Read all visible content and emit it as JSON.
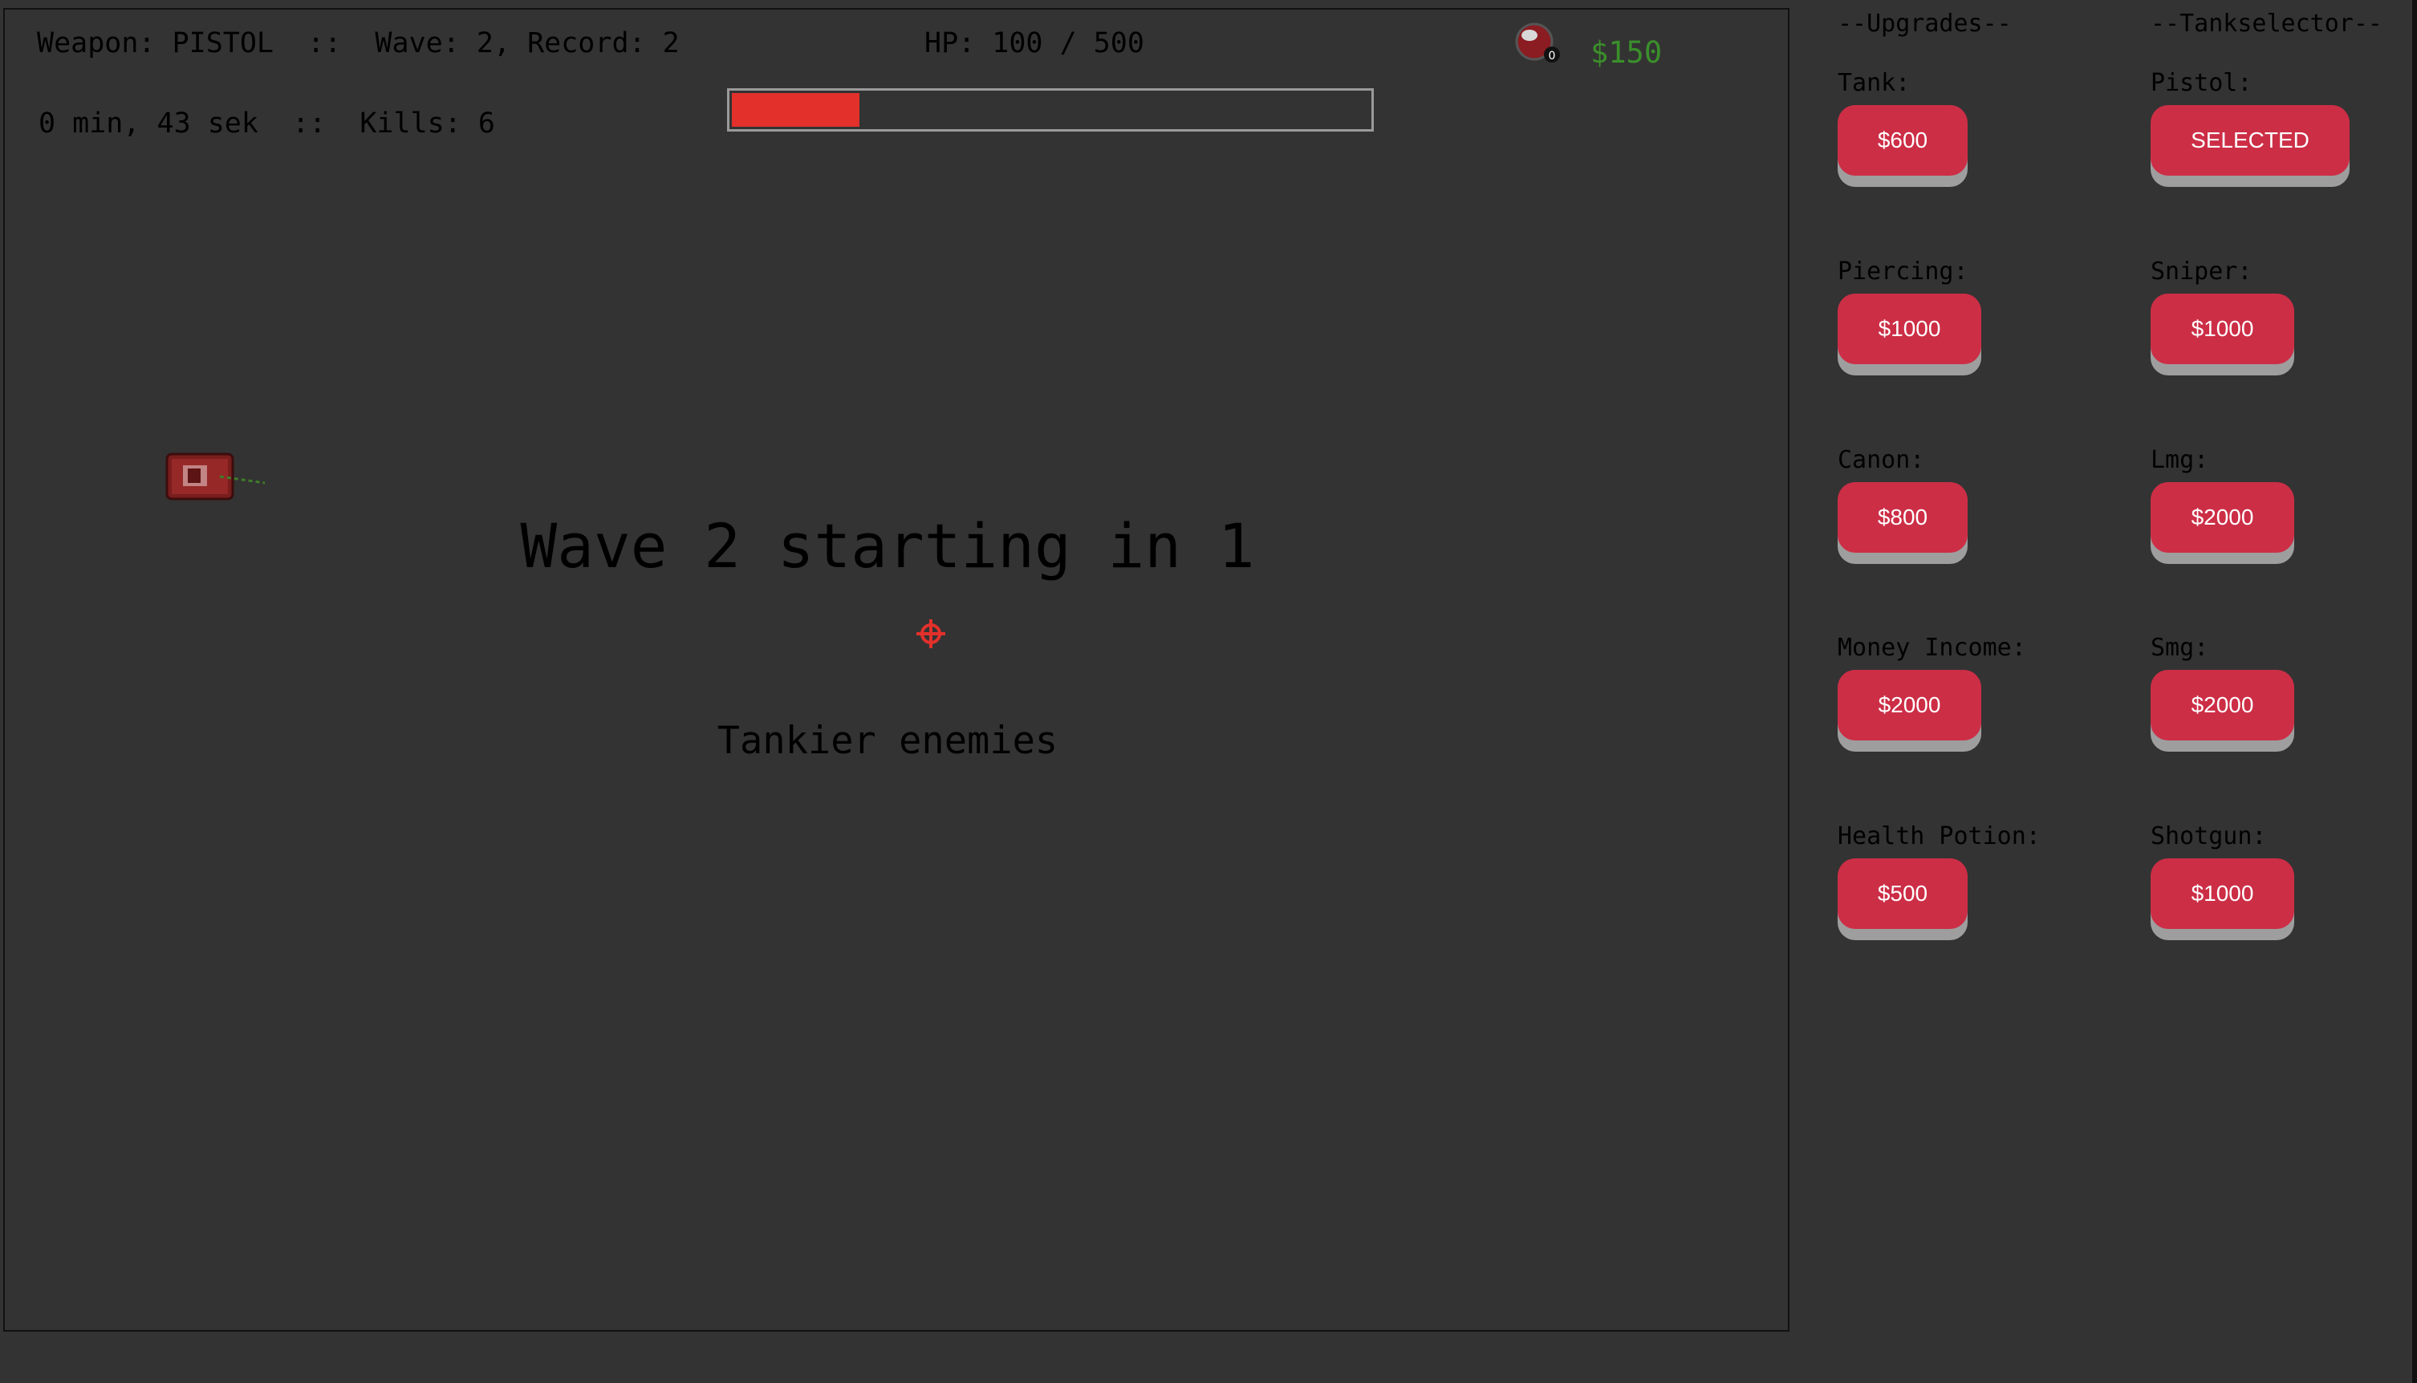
{
  "hud": {
    "weapon_wave_record": "Weapon: PISTOL  ::  Wave: 2, Record: 2",
    "time_kills": "0 min, 43 sek  ::  Kills: 6",
    "hp": "HP: 100 / 500",
    "hp_fraction": 0.2,
    "money": "$150"
  },
  "overlay": {
    "wave_announcement": "Wave 2 starting in 1",
    "wave_modifier": "Tankier enemies"
  },
  "upgrades": {
    "heading": "--Upgrades--",
    "items": [
      {
        "label": "Tank:",
        "button": "$600"
      },
      {
        "label": "Piercing:",
        "button": "$1000"
      },
      {
        "label": "Canon:",
        "button": "$800"
      },
      {
        "label": "Money Income:",
        "button": "$2000"
      },
      {
        "label": "Health Potion:",
        "button": "$500"
      }
    ]
  },
  "tankselector": {
    "heading": "--Tankselector--",
    "items": [
      {
        "label": "Pistol:",
        "button": "SELECTED"
      },
      {
        "label": "Sniper:",
        "button": "$1000"
      },
      {
        "label": "Lmg:",
        "button": "$2000"
      },
      {
        "label": "Smg:",
        "button": "$2000"
      },
      {
        "label": "Shotgun:",
        "button": "$1000"
      }
    ]
  },
  "colors": {
    "background": "#333333",
    "button": "#cc2e46",
    "button_shadow": "#9e9e9e",
    "hp_fill": "#e3302b",
    "money": "#3b8f2b"
  },
  "icons": {
    "bomb": "bomb-icon",
    "tank": "player-tank-icon",
    "crosshair": "crosshair-icon"
  }
}
